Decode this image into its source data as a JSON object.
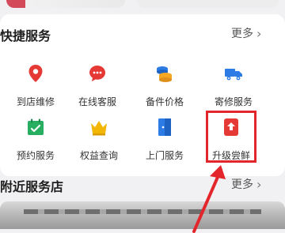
{
  "quick_services": {
    "title": "快捷服务",
    "more": "更多",
    "items": [
      {
        "label": "到店维修",
        "icon": "location-pin-icon"
      },
      {
        "label": "在线客服",
        "icon": "chat-bubble-icon"
      },
      {
        "label": "备件价格",
        "icon": "coin-stack-icon"
      },
      {
        "label": "寄修服务",
        "icon": "truck-icon"
      },
      {
        "label": "预约服务",
        "icon": "calendar-check-icon"
      },
      {
        "label": "权益查询",
        "icon": "crown-icon"
      },
      {
        "label": "上门服务",
        "icon": "door-icon"
      },
      {
        "label": "升级尝鲜",
        "icon": "upgrade-arrow-icon"
      }
    ]
  },
  "nearby": {
    "title": "附近服务店",
    "more": "更多"
  },
  "colors": {
    "red": "#e53935",
    "orange": "#f5a623",
    "blue": "#2d7be5",
    "green": "#27ae60",
    "gold": "#f2b705",
    "highlight": "#e3262c"
  }
}
